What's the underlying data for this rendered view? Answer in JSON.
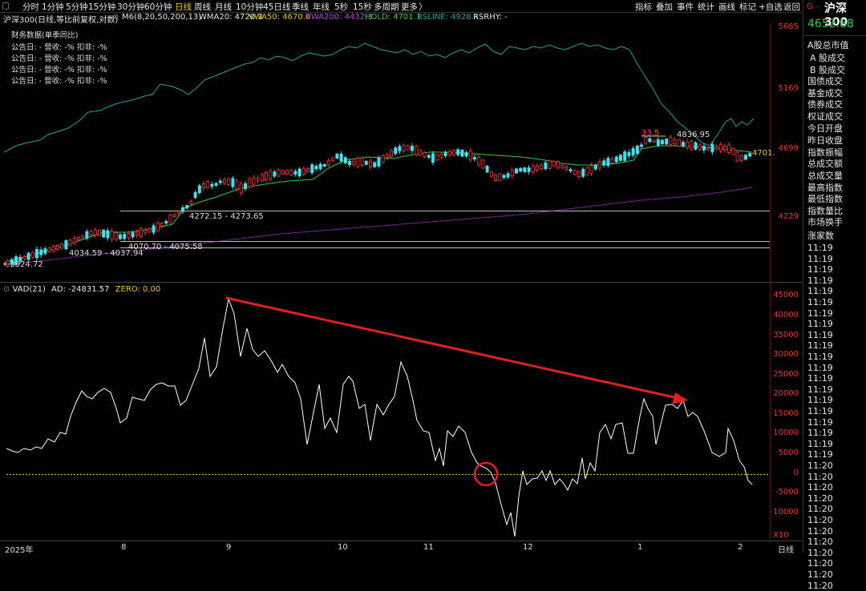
{
  "toolbar": {
    "periods": [
      "分时",
      "1分钟",
      "5分钟",
      "15分钟",
      "30分钟",
      "60分钟",
      "日线",
      "周线",
      "月线",
      "10分钟",
      "45日线",
      "季线",
      "年线",
      "5秒",
      "15秒",
      "多周期",
      "更多"
    ],
    "active": "日线",
    "more_arrow": "〉",
    "right_buttons": [
      "指标",
      "叠加",
      "事件",
      "统计",
      "画线",
      "标记",
      "+自选",
      "返回"
    ]
  },
  "indicator_bar": {
    "symbol": "沪深300(日线,等比前复权,对数)",
    "m6": "M6(8,20,50,200,13)",
    "wma20": "WMA20: 4720.3",
    "vwa50": "VWA50: 4670.6",
    "vwa200": "VWA200: 4432.3",
    "hold": "HOLD: 4701.1",
    "rsline": "RSLINE: 4928.4",
    "rsrhy": "RSRHY: -"
  },
  "financial": {
    "title": "财务数据(单季同比)",
    "rows": [
      "公告日: -   营收: -%   扣非: -%",
      "公告日: -   营收: -%   扣非: -%",
      "公告日: -   营收: -%   扣非: -%",
      "公告日: -   营收: -%   扣非: -%"
    ]
  },
  "price_axis": [
    "5685",
    "5169",
    "4699",
    "4229"
  ],
  "price_labels": {
    "low": "←3924.72",
    "h1": "4272.15 - 4273.65",
    "h2": "4034.59 - 4037.94",
    "h3": "4070.70 - 4075.58",
    "high_left": "33.5",
    "high_right": "4836.95",
    "last": "4701."
  },
  "vad_bar": {
    "vad": "VAD(21)",
    "ad": "AD: -24831.57",
    "zero": "ZERO: 0.00"
  },
  "vad_axis": [
    "45000",
    "40000",
    "35000",
    "30000",
    "25000",
    "20000",
    "15000",
    "10000",
    "5000",
    "0",
    "-5000",
    "-10000"
  ],
  "vad_unit": "X10",
  "x_axis": [
    "2025年",
    "8",
    "9",
    "10",
    "11",
    "12",
    "1",
    "2",
    "日线"
  ],
  "right_panel": {
    "g": "G",
    "dash": "-",
    "name": "沪深300",
    "price": "4652.88",
    "menu": [
      "A股总市值",
      "A 股成交",
      "B 股成交",
      "国债成交",
      "基金成交",
      "债券成交",
      "权证成交",
      "今日开盘",
      "昨日收盘",
      "指数振幅",
      "总成交额",
      "总成交量",
      "最高指数",
      "最低指数",
      "指数量比",
      "市场换手",
      "涨家数"
    ],
    "times": [
      "11:19",
      "11:19",
      "11:19",
      "11:19",
      "11:19",
      "11:19",
      "11:19",
      "11:19",
      "11:19",
      "11:19",
      "11:19",
      "11:19",
      "11:19",
      "11:19",
      "11:19",
      "11:19",
      "11:19",
      "11:19",
      "11:19",
      "11:19",
      "11:20",
      "11:20",
      "11:20",
      "11:20",
      "11:20",
      "11:20",
      "11:20",
      "11:20",
      "11:20",
      "11:20",
      "11:20",
      "11:20"
    ]
  },
  "colors": {
    "up": "#ff3030",
    "down": "#40e0f0",
    "ma_green": "#2ecc40",
    "ma_purple": "#b030e0",
    "rsline": "#20a0a0",
    "vad": "#ffffff",
    "zero": "#e8d000",
    "arrow": "#e02020",
    "circle": "#e02020"
  }
}
